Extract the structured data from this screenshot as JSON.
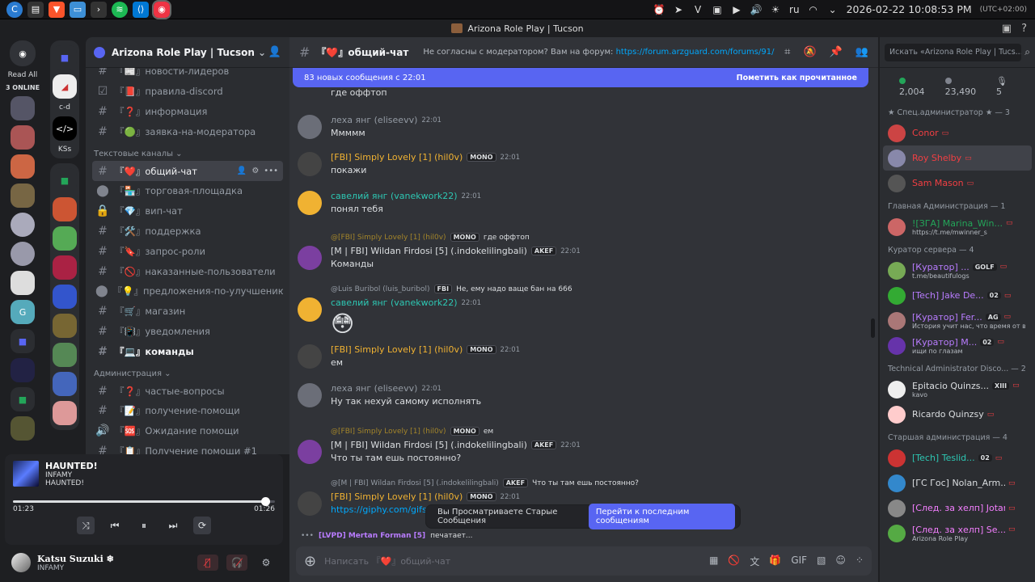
{
  "taskbar": {
    "lang": "ru",
    "clock": "2026-02-22 10:08:53 PM",
    "tz": "(UTC+02:00)"
  },
  "window": {
    "title": "Arizona Role Play | Tucson"
  },
  "servers": {
    "read_all": "Read All",
    "online": "3 ONLINE",
    "cd": "c-d",
    "kss": "KSs"
  },
  "guild": {
    "name": "Arizona Role Play | Tucson"
  },
  "channels": [
    {
      "icon": "#",
      "label": "『📰』новости-лидеров",
      "state": "normal"
    },
    {
      "icon": "☑",
      "label": "『📕』правила-discord",
      "state": "normal"
    },
    {
      "icon": "#",
      "label": "『❓』информация",
      "state": "normal"
    },
    {
      "icon": "#",
      "label": "『🟢』заявка-на-модератора",
      "state": "normal"
    }
  ],
  "category1": "Текстовые каналы",
  "channels2": [
    {
      "icon": "#",
      "label": "『❤️』общий-чат",
      "state": "active"
    },
    {
      "icon": "⬤",
      "label": "『🏪』торговая-площадка",
      "state": "normal"
    },
    {
      "icon": "🔒",
      "label": "『💎』вип-чат",
      "state": "normal"
    },
    {
      "icon": "#",
      "label": "『🛠️』поддержка",
      "state": "normal"
    },
    {
      "icon": "#",
      "label": "『🔖』запрос-роли",
      "state": "normal"
    },
    {
      "icon": "#",
      "label": "『🚫』наказанные-пользователи",
      "state": "normal"
    },
    {
      "icon": "⬤",
      "label": "『💡』предложения-по-улучшению...",
      "state": "normal"
    },
    {
      "icon": "#",
      "label": "『🛒』магазин",
      "state": "normal"
    },
    {
      "icon": "#",
      "label": "『📳』уведомления",
      "state": "normal"
    },
    {
      "icon": "#",
      "label": "『💻』команды",
      "state": "unread"
    }
  ],
  "category2": "Администрация",
  "channels3": [
    {
      "icon": "#",
      "label": "『❓』частые-вопросы",
      "state": "normal"
    },
    {
      "icon": "#",
      "label": "『📝』получение-помощи",
      "state": "normal"
    },
    {
      "icon": "🔊",
      "label": "『🆘』Ожидание помощи",
      "state": "normal"
    },
    {
      "icon": "#",
      "label": "『📋』Получение помощи #1",
      "state": "normal"
    }
  ],
  "player": {
    "title": "HAUNTED!",
    "artist": "INFAMY",
    "album": "HAUNTED!",
    "elapsed": "01:23",
    "duration": "01:26",
    "progress": 0.965
  },
  "user": {
    "name": "Katsu Suzuki ❄",
    "status": "INFAMY"
  },
  "header": {
    "channel": "『❤️』общий-чат",
    "topic": "Не согласны с модератором? Вам на форум:",
    "link": "https://forum.arzguard.com/forums/91/"
  },
  "newbar": {
    "text": "83 новых сообщения с 22:01",
    "mark": "Пометить как прочитанное"
  },
  "messages": [
    {
      "text": "где оффтоп"
    },
    {
      "name": "леха янг (eliseevv)",
      "time": "22:01",
      "text": "Ммммм"
    },
    {
      "name": "[FBI] Simply Lovely [1] (hil0v)",
      "tag": "MONO",
      "time": "22:01",
      "text": "покажи"
    },
    {
      "name": "савелий янг (vanekwork22)",
      "time": "22:01",
      "text": "понял тебя"
    },
    {
      "reply_name": "@[FBI] Simply Lovely [1] (hil0v)",
      "reply_tag": "MONO",
      "reply_text": "где оффтоп",
      "name": "[M | FBI] Wildan Firdosi [5] (.indokelilingbali)",
      "tag": "AKEF",
      "time": "22:01",
      "text": "Команды"
    },
    {
      "reply_name": "@Luis Buribol (luis_buribol)",
      "reply_tag": "FBI",
      "reply_text": "Не, ему надо ваще бан на 666",
      "name": "савелий янг (vanekwork22)",
      "time": "22:01",
      "text": "😳"
    },
    {
      "name": "[FBI] Simply Lovely [1] (hil0v)",
      "tag": "MONO",
      "time": "22:01",
      "text": "ем"
    },
    {
      "name": "леха янг (eliseevv)",
      "time": "22:01",
      "text": "Ну так нехуй самому исполнять"
    },
    {
      "reply_name": "@[FBI] Simply Lovely [1] (hil0v)",
      "reply_tag": "MONO",
      "reply_text": "ем",
      "name": "[M | FBI] Wildan Firdosi [5] (.indokelilingbali)",
      "tag": "AKEF",
      "time": "22:01",
      "text": "Что ты там ешь постоянно?"
    },
    {
      "reply_name": "@[M | FBI] Wildan Firdosi [5] (.indokelilingbali)",
      "reply_tag": "AKEF",
      "reply_text": "Что ты там ешь постоянно?",
      "name": "[FBI] Simply Lovely [1] (hil0v)",
      "tag": "MONO",
      "time": "22:01",
      "text": "https://giphy.com/gifs/l"
    }
  ],
  "typing": {
    "name": "[LVPD] Mertan Forman [5]",
    "text": "печатает..."
  },
  "oldbar": {
    "text": "Вы Просматриваете Старые Сообщения",
    "jump": "Перейти к последним сообщениям"
  },
  "composer": {
    "placeholder": "Написать 『❤️』общий-чат"
  },
  "members": {
    "search": "Искать «Arizona Role Play | Tucs...",
    "online": "2,004",
    "total": "23,490",
    "mic": "5",
    "groups": [
      {
        "title": "★ Спец.администратор ★ — 3",
        "items": [
          {
            "name": "Conor",
            "color": "#f23f43"
          },
          {
            "name": "Roy Shelby",
            "color": "#f23f43"
          },
          {
            "name": "Sam Mason",
            "color": "#f23f43"
          }
        ]
      },
      {
        "title": "Главная Администрация — 1",
        "items": [
          {
            "name": "![ЗГА] Marina_Win...",
            "sub": "https://t.me/mwinner_s",
            "color": "#23a559"
          }
        ]
      },
      {
        "title": "Куратор сервера — 4",
        "items": [
          {
            "name": "[Куратор] ...",
            "badge": "GOLF",
            "sub": "t.me/beautifulogs",
            "color": "#b97cff"
          },
          {
            "name": "[Tech] Jake De...",
            "badge": "02",
            "color": "#b97cff"
          },
          {
            "name": "[Куратор] Fer...",
            "badge": "AG",
            "sub": "История учит нас, что время от вре",
            "color": "#b97cff"
          },
          {
            "name": "[Куратор] M...",
            "badge": "02",
            "sub": "ищи по глазам",
            "color": "#b97cff"
          }
        ]
      },
      {
        "title": "Technical Administrator Disco... — 2",
        "items": [
          {
            "name": "Epitacio Quinzs...",
            "badge": "XIII",
            "sub": "kavo",
            "color": "#dbdee1"
          },
          {
            "name": "Ricardo Quinzsy",
            "color": "#dbdee1"
          }
        ]
      },
      {
        "title": "Старшая администрация — 4",
        "items": [
          {
            "name": "[Tech] Teslid...",
            "badge": "02",
            "color": "#2dc7b3"
          },
          {
            "name": "[ГС Гос] Nolan_Arm...",
            "color": "#dbdee1"
          },
          {
            "name": "[След. за хелп] Jotar...",
            "color": "#f47fff"
          },
          {
            "name": "[След. за хелп] Se...",
            "sub": "Arizona Role Play",
            "color": "#f47fff"
          }
        ]
      }
    ]
  },
  "colors": {
    "accent": "#5865f2",
    "bg": "#313338",
    "sidebar": "#2b2d31"
  }
}
